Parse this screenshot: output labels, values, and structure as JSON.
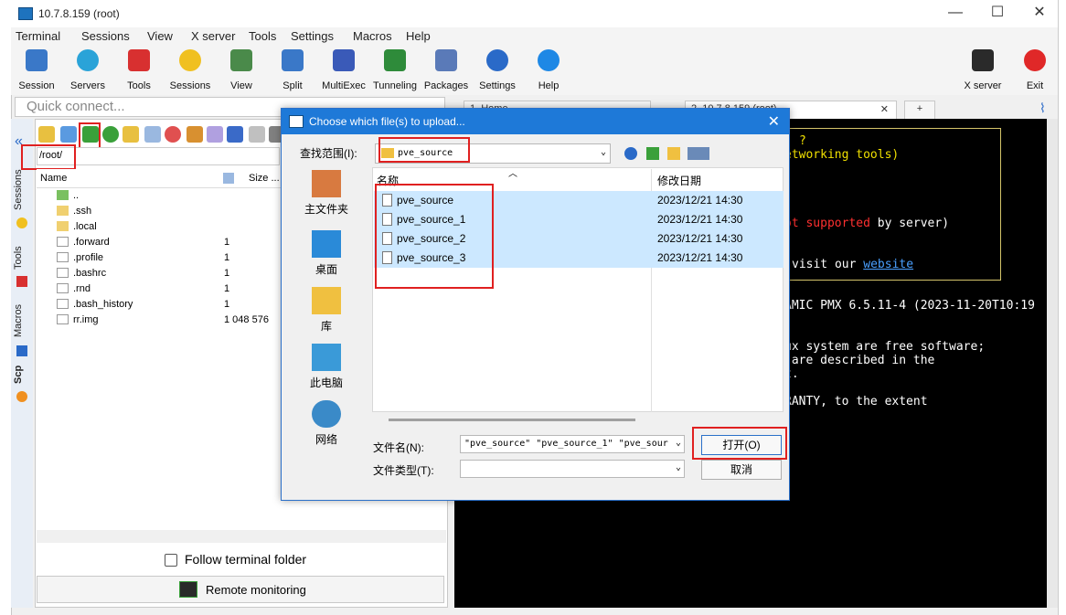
{
  "window": {
    "title": "10.7.8.159 (root)",
    "controls": [
      "—",
      "☐",
      "✕"
    ]
  },
  "menu": [
    "Terminal",
    "Sessions",
    "View",
    "X server",
    "Tools",
    "Settings",
    "Macros",
    "Help"
  ],
  "toolbar": {
    "left": [
      "Session",
      "Servers",
      "Tools",
      "Sessions",
      "View",
      "Split",
      "MultiExec",
      "Tunneling",
      "Packages",
      "Settings",
      "Help"
    ],
    "right": [
      "X server",
      "Exit"
    ]
  },
  "quick_connect": {
    "placeholder": "Quick connect..."
  },
  "sidebar_tabs": [
    "Sessions",
    "Tools",
    "Macros",
    "Scp"
  ],
  "file_browser": {
    "path": "/root/",
    "columns": [
      "Name",
      "Size ..."
    ],
    "files": [
      {
        "name": "..",
        "size": "",
        "kind": "folder"
      },
      {
        "name": ".ssh",
        "size": "",
        "kind": "folder"
      },
      {
        "name": ".local",
        "size": "",
        "kind": "folder"
      },
      {
        "name": ".forward",
        "size": "1",
        "kind": "file"
      },
      {
        "name": ".profile",
        "size": "1",
        "kind": "file"
      },
      {
        "name": ".bashrc",
        "size": "1",
        "kind": "file"
      },
      {
        "name": ".rnd",
        "size": "1",
        "kind": "file"
      },
      {
        "name": ".bash_history",
        "size": "1",
        "kind": "file"
      },
      {
        "name": "rr.img",
        "size": "1 048 576",
        "kind": "file"
      }
    ],
    "follow_label": "Follow terminal folder",
    "remote_monitoring": "Remote monitoring"
  },
  "terminal": {
    "tabs": [
      "1. Home",
      "2. 10.7.8.159 (root)"
    ],
    "lines": [
      {
        "text": "?",
        "color": "#f0e000"
      },
      {
        "text": "etworking tools)",
        "color": "#f0e000"
      },
      {
        "text": "ot supported",
        "color": "#ff3030",
        "suffix": " by server)"
      },
      {
        "text": "visit our ",
        "color": "#ffffff",
        "link": "website"
      },
      {
        "text": "AMIC PMX 6.5.11-4 (2023-11-20T10:19",
        "color": "#ffffff"
      },
      {
        "text": "ux system are free software;",
        "color": "#ffffff"
      },
      {
        "text": " are described in the",
        "color": "#ffffff"
      },
      {
        "text": "t.",
        "color": "#ffffff"
      },
      {
        "text": "RANTY, to the extent",
        "color": "#ffffff"
      }
    ]
  },
  "dialog": {
    "title": "Choose which file(s) to upload...",
    "lookin_label": "查找范围(I):",
    "lookin_value": "pve_source",
    "places": [
      "主文件夹",
      "桌面",
      "库",
      "此电脑",
      "网络"
    ],
    "columns": [
      "名称",
      "修改日期"
    ],
    "files": [
      {
        "name": "pve_source",
        "date": "2023/12/21 14:30"
      },
      {
        "name": "pve_source_1",
        "date": "2023/12/21 14:30"
      },
      {
        "name": "pve_source_2",
        "date": "2023/12/21 14:30"
      },
      {
        "name": "pve_source_3",
        "date": "2023/12/21 14:30"
      }
    ],
    "filename_label": "文件名(N):",
    "filename_value": "\"pve_source\" \"pve_source_1\" \"pve_sour",
    "filetype_label": "文件类型(T):",
    "filetype_value": "",
    "open_button": "打开(O)",
    "cancel_button": "取消"
  },
  "colors": {
    "dialog_title_bg": "#1e79d8",
    "selection_bg": "#cce8ff",
    "highlight": "#e02020",
    "terminal_bg": "#000000"
  }
}
